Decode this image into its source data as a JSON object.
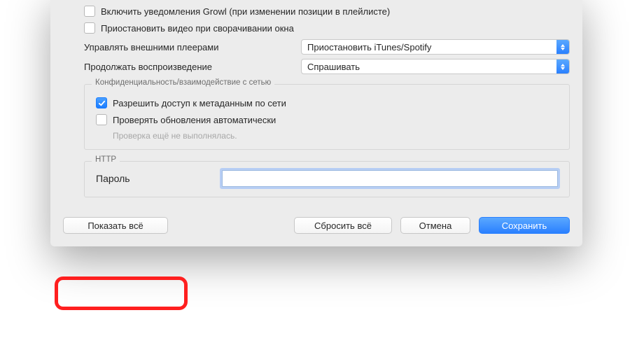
{
  "checkboxes": {
    "growl": {
      "checked": false,
      "label": "Включить уведомления Growl (при изменении позиции в плейлисте)"
    },
    "pauseOnMinimize": {
      "checked": false,
      "label": "Приостановить видео при сворачивании окна"
    }
  },
  "selects": {
    "externalPlayers": {
      "label": "Управлять внешними плеерами",
      "value": "Приостановить iTunes/Spotify"
    },
    "continuePlayback": {
      "label": "Продолжать воспроизведение",
      "value": "Спрашивать"
    }
  },
  "privacyGroup": {
    "legend": "Конфиденциальность/взаимодействие с сетью",
    "allowMetadata": {
      "checked": true,
      "label": "Разрешить доступ к метаданным по сети"
    },
    "checkUpdates": {
      "checked": false,
      "label": "Проверять обновления автоматически"
    },
    "statusText": "Проверка ещё не выполнялась."
  },
  "httpGroup": {
    "legend": "HTTP",
    "passwordLabel": "Пароль",
    "passwordValue": ""
  },
  "buttons": {
    "showAll": "Показать всё",
    "resetAll": "Сбросить всё",
    "cancel": "Отмена",
    "save": "Сохранить"
  }
}
